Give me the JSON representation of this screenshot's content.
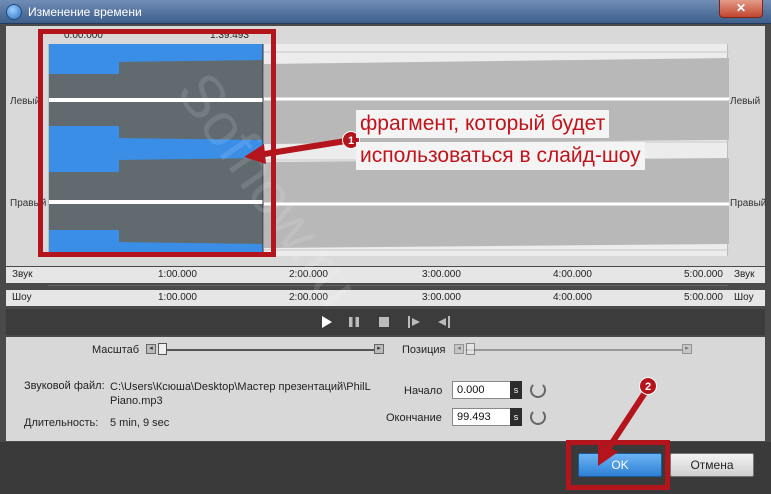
{
  "window": {
    "title": "Изменение времени",
    "close_glyph": "✕"
  },
  "waveform": {
    "start_time": "0:00.000",
    "end_time": "1:39.493",
    "channel_left": "Левый",
    "channel_right": "Правый"
  },
  "ruler_sound": {
    "label": "Звук",
    "ticks": [
      "1:00.000",
      "2:00.000",
      "3:00.000",
      "4:00.000",
      "5:00.000"
    ]
  },
  "ruler_show": {
    "label": "Шоу",
    "ticks": [
      "1:00.000",
      "2:00.000",
      "3:00.000",
      "4:00.000",
      "5:00.000"
    ]
  },
  "playback": {
    "play_icon": "play-icon",
    "pause_icon": "pause-icon",
    "stop_icon": "stop-icon",
    "mark_start_icon": "mark-start-icon",
    "mark_end_icon": "mark-end-icon"
  },
  "settings": {
    "scale_label": "Масштаб",
    "position_label": "Позиция",
    "file_label": "Звуковой файл:",
    "file_path": "C:\\Users\\Ксюша\\Desktop\\Мастер презентаций\\PhilL Piano.mp3",
    "duration_label": "Длительность:",
    "duration_value": "5 min, 9 sec",
    "start_label": "Начало",
    "start_value": "0.000",
    "end_label": "Окончание",
    "end_value": "99.493",
    "unit": "s"
  },
  "buttons": {
    "ok": "OK",
    "cancel": "Отмена"
  },
  "annotations": {
    "callout_line1": "фрагмент, который будет",
    "callout_line2": "использоваться в слайд-шоу",
    "badge1": "1",
    "badge2": "2",
    "watermark": "Sofhow.ru"
  },
  "colors": {
    "selection": "#3a8ee6",
    "accent_red": "#b4141c",
    "ok_button": "#2f80d6"
  }
}
